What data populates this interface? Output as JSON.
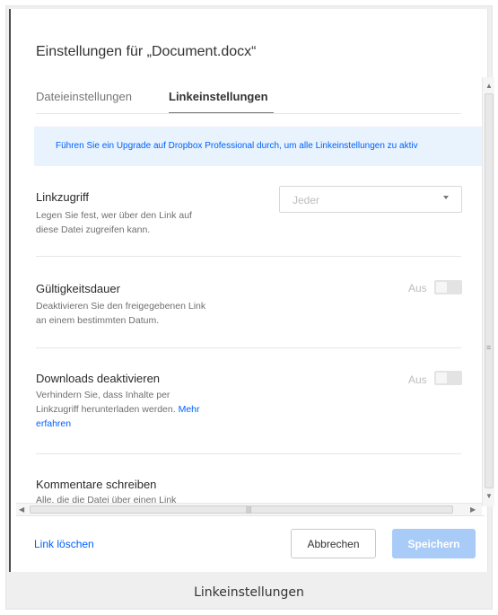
{
  "dialog": {
    "title": "Einstellungen für „Document.docx“",
    "tabs": [
      {
        "label": "Dateieinstellungen",
        "active": false
      },
      {
        "label": "Linkeinstellungen",
        "active": true
      }
    ],
    "banner": "Führen Sie ein Upgrade auf Dropbox Professional durch, um alle Linkeinstellungen zu aktiv",
    "settings": {
      "link_access": {
        "title": "Linkzugriff",
        "desc_line1": "Legen Sie fest, wer über den Link auf",
        "desc_line2": "diese Datei zugreifen kann.",
        "select_value": "Jeder"
      },
      "expiry": {
        "title": "Gültigkeitsdauer",
        "desc_line1": "Deaktivieren Sie den freigegebenen Link",
        "desc_line2": "an einem bestimmten Datum.",
        "toggle_label": "Aus"
      },
      "downloads": {
        "title": "Downloads deaktivieren",
        "desc_line1": "Verhindern Sie, dass Inhalte per",
        "desc_line2": "Linkzugriff herunterladen werden.",
        "link_text_1": "Mehr",
        "link_text_2": "erfahren",
        "toggle_label": "Aus"
      },
      "comments": {
        "title": "Kommentare schreiben",
        "desc_partial": "Alle, die die Datei über einen Link"
      }
    },
    "footer": {
      "delete_label": "Link löschen",
      "cancel_label": "Abbrechen",
      "save_label": "Speichern"
    }
  },
  "caption": "Linkeinstellungen",
  "colors": {
    "accent": "#0061fe",
    "banner_bg": "#e8f3fd",
    "save_disabled": "#a8ccf7"
  }
}
